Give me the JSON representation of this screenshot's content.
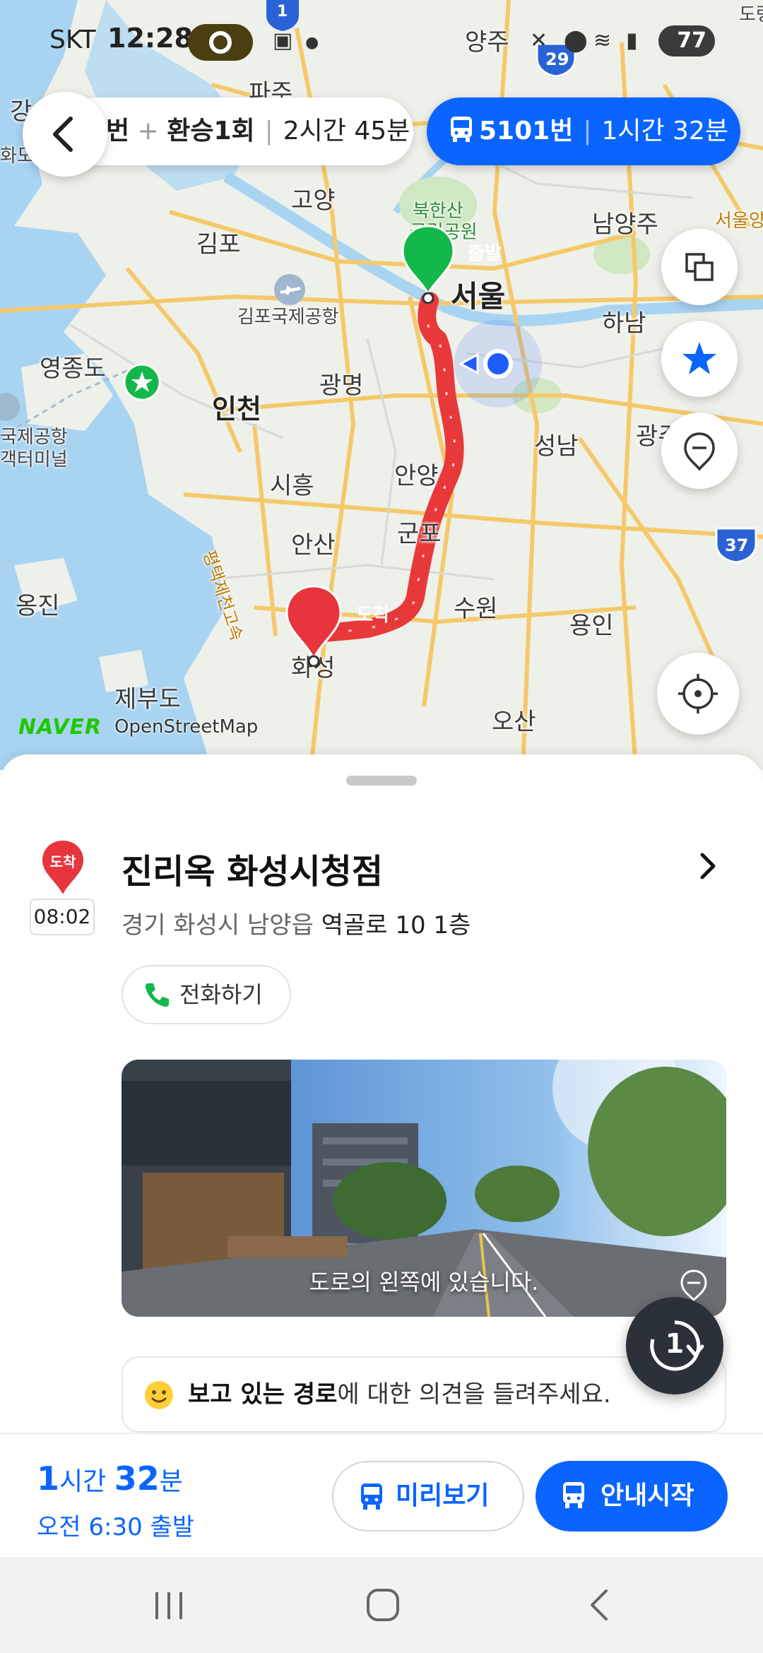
{
  "status_bar": {
    "carrier": "SKT",
    "time": "12:28",
    "battery": "77"
  },
  "route_tabs": [
    {
      "prefix": "번",
      "plus": "+",
      "transfer": "환승1회",
      "duration": "2시간 45분"
    },
    {
      "bus": "5101번",
      "duration": "1시간 32분"
    }
  ],
  "map": {
    "labels": {
      "paju": "파주",
      "yangju": "양주",
      "goyang": "고양",
      "bukhansan": "북한산",
      "national_park": "국립공원",
      "namyangju": "남양주",
      "seoul_road": "서울양",
      "gimpo": "김포",
      "start": "출발",
      "seoul": "서울",
      "gimpo_airport": "김포국제공항",
      "hanam": "하남",
      "yeongjongdo": "영종도",
      "gwangmyeong": "광명",
      "incheon": "인천",
      "airport_a": "국제공항",
      "airport_b": "객터미널",
      "seongnam": "성남",
      "gwangju": "광주",
      "siheung": "시흥",
      "anyang": "안양",
      "gunpo": "군포",
      "ansan": "안산",
      "expressway": "평택제천고속",
      "ongjin": "옹진",
      "arrive": "도착",
      "suwon": "수원",
      "yongin": "용인",
      "hwaseong": "화성",
      "jebudo": "제부도",
      "osan": "오산",
      "left_edge": "강",
      "left_edge2": "화도",
      "right_edge": "도령"
    },
    "highways": [
      "1",
      "29",
      "37"
    ],
    "credit_logo": "NAVER",
    "credit": "OpenStreetMap"
  },
  "destination": {
    "pin_label": "도착",
    "time": "08:02",
    "name": "진리옥 화성시청점",
    "address_a": "경기 화성시 남양읍 ",
    "address_b": "역골로 10 1층",
    "call_label": "전화하기",
    "street_caption": "도로의 왼쪽에 있습니다.",
    "float_number": "1"
  },
  "feedback": {
    "bold": "보고 있는 경로",
    "rest": "에 대한 의견을 들려주세요."
  },
  "footer": {
    "hours_num": "1",
    "hours_unit": "시간",
    "mins_num": "32",
    "mins_unit": "분",
    "depart": "오전 6:30 출발",
    "preview_label": "미리보기",
    "start_label": "안내시작"
  },
  "colors": {
    "accent": "#0a64ff",
    "route": "#e8393a",
    "start_pin": "#12b84a",
    "end_pin": "#e8343d"
  },
  "icons": {
    "back": "chevron-left-icon",
    "layers": "layers-icon",
    "star": "star-icon",
    "pin": "location-pin-icon",
    "target": "crosshair-icon",
    "bus": "bus-icon",
    "phone": "phone-icon",
    "smile": "smile-icon"
  }
}
